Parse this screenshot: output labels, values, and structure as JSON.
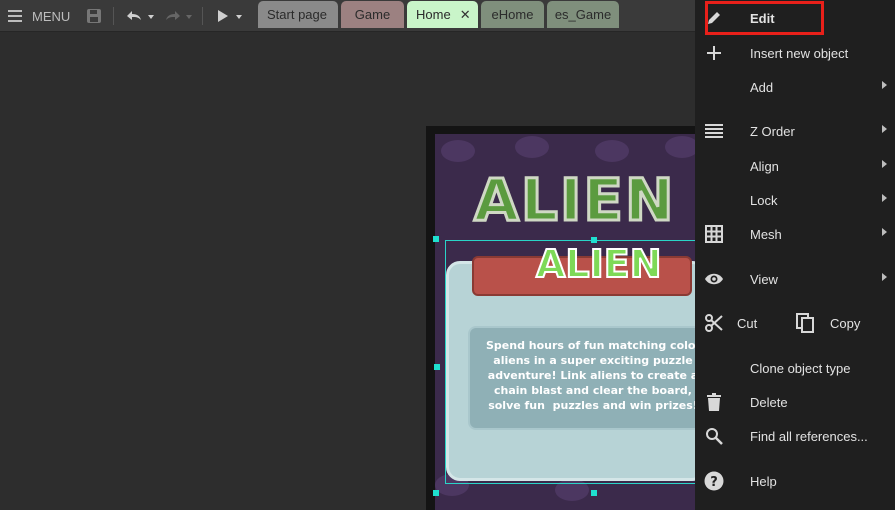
{
  "toolbar": {
    "menu_label": "MENU",
    "tabs": [
      {
        "label": "Start page",
        "color": "#8a8a8a"
      },
      {
        "label": "Game",
        "color": "#9c8181"
      },
      {
        "label": "Home",
        "color": "#c9f5c9",
        "active": true
      },
      {
        "label": "eHome",
        "color": "#7f8f7c"
      },
      {
        "label": "es_Game",
        "color": "#7f8f7c"
      }
    ]
  },
  "canvas": {
    "big_title": "ALIEN",
    "small_title": "ALIEN",
    "description": "Spend hours of fun matching colorfu\naliens in a super exciting puzzle\nadventure! Link aliens to create a\nchain blast and clear the board,\nsolve fun  puzzles and win prizes!"
  },
  "context_menu": {
    "items": [
      {
        "label": "Edit",
        "icon": "pencil-icon",
        "highlighted": true
      },
      {
        "label": "Insert new object",
        "icon": "plus-icon"
      },
      {
        "label": "Add",
        "submenu": true
      },
      {
        "label": "Z Order",
        "icon": "layers-icon",
        "submenu": true
      },
      {
        "label": "Align",
        "submenu": true
      },
      {
        "label": "Lock",
        "submenu": true
      },
      {
        "label": "Mesh",
        "icon": "grid-icon",
        "submenu": true
      },
      {
        "label": "View",
        "icon": "eye-icon",
        "submenu": true
      },
      {
        "label": "Cut",
        "icon": "scissors-icon"
      },
      {
        "label": "Copy",
        "icon": "copy-icon"
      },
      {
        "label": "Clone object type"
      },
      {
        "label": "Delete",
        "icon": "trash-icon"
      },
      {
        "label": "Find all references...",
        "icon": "search-icon"
      },
      {
        "label": "Help",
        "icon": "help-icon"
      }
    ]
  },
  "colors": {
    "highlight_border": "#e8201a",
    "selection_handle": "#1fe0d0",
    "menu_bg": "#1f1f1f"
  }
}
